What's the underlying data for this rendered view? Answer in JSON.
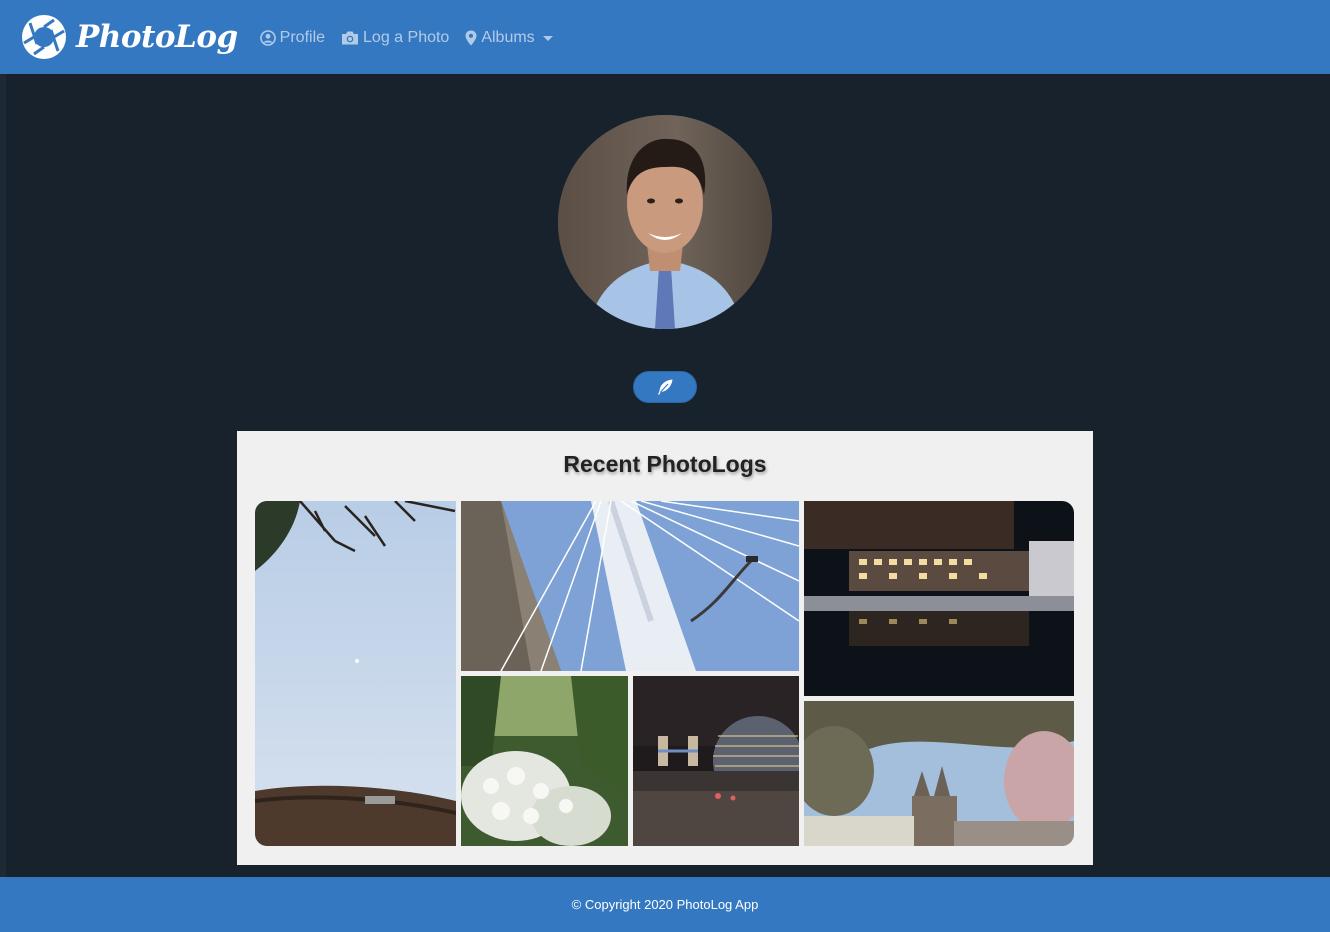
{
  "app": {
    "brand_name": "PhotoLog",
    "brand_color": "#3478c1",
    "background_color": "#18222d"
  },
  "nav": {
    "items": [
      {
        "label": "Profile",
        "icon": "user-circle-icon"
      },
      {
        "label": "Log a Photo",
        "icon": "camera-icon"
      },
      {
        "label": "Albums",
        "icon": "map-marker-icon",
        "dropdown": true
      }
    ]
  },
  "profile": {
    "avatar_icon": "profile-photo",
    "edit_button_icon": "feather-icon"
  },
  "recent": {
    "title": "Recent PhotoLogs",
    "photos": [
      {
        "subject": "sky with branches and thatched roof"
      },
      {
        "subject": "cable-stayed bridge pylon"
      },
      {
        "subject": "office building reflected in pool at night"
      },
      {
        "subject": "white flowering shrub"
      },
      {
        "subject": "city hall and tower bridge at night"
      },
      {
        "subject": "blossom trees and cathedral spires"
      }
    ]
  },
  "footer": {
    "copyright": "© Copyright 2020 PhotoLog App"
  }
}
